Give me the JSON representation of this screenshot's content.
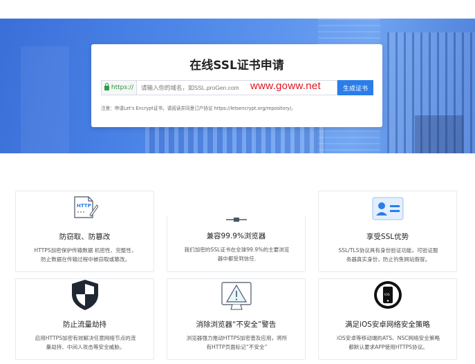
{
  "hero": {
    "title": "在线SSL证书申请",
    "prefix": "https://",
    "input_placeholder": "请输入你的域名，如SSL.proGen.com",
    "submit_label": "生成证书",
    "watermark": "www.goww.net",
    "note": "注意：申请Let's Encrypt证书，请阅读并同意订户协议 https://letsencrypt.org/repository/。"
  },
  "features": [
    {
      "icon": "https-document-icon",
      "title": "防窃取、防篡改",
      "line1": "HTTPS加密保护传输数据 机密性、完整性，",
      "line2": "防止数据在传输过程中被窃取或篡改。",
      "icon_text": "HTTP"
    },
    {
      "icon": "key-icon",
      "title": "兼容99.9%浏览器",
      "line1": "我们加密的SSL证书在全球99.9%的主要浏览",
      "line2": "器中都受到信任."
    },
    {
      "icon": "id-card-icon",
      "title": "享受SSL优势",
      "line1": "SSL/TLS协议具有身份验证功能，可验证服",
      "line2": "务器真实身份，防止钓鱼网站假冒。"
    },
    {
      "icon": "shield-icon",
      "title": "防止流量劫持",
      "line1": "启用HTTPS加密有效解决任意网络节点的流",
      "line2": "量劫持、中间人攻击等安全威胁。"
    },
    {
      "icon": "warning-icon",
      "title": "消除浏览器“不安全”警告",
      "line1": "浏览器强力推动HTTPS加密普及应用，将所",
      "line2": "有HTTP页面标记“不安全”"
    },
    {
      "icon": "ios-phone-icon",
      "title": "满足iOS安卓网络安全策略",
      "line1": "iOS安卓等移动端的ATS、NSC网络安全策略",
      "line2": "都默认要求APP使用HTTPS协议。",
      "icon_text": "IOS"
    }
  ],
  "colors": {
    "accent": "#2b7de9",
    "watermark": "#e0141e",
    "hero": "#4a82e6"
  }
}
